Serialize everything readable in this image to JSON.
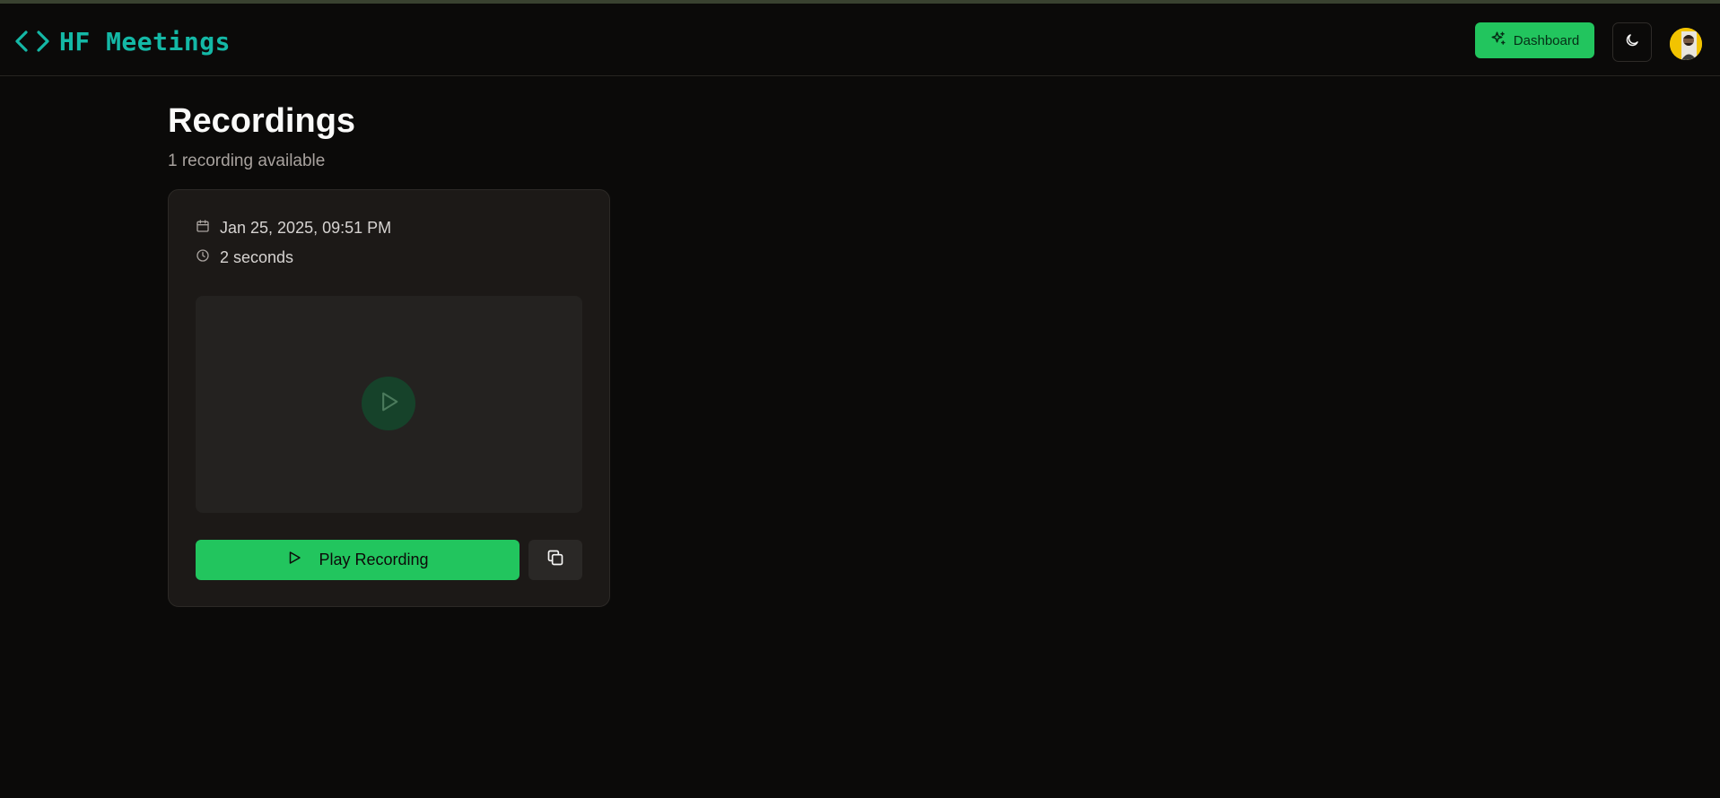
{
  "app": {
    "name": "HF Meetings"
  },
  "header": {
    "dashboard_label": "Dashboard"
  },
  "page": {
    "title": "Recordings",
    "subtitle": "1 recording available"
  },
  "recordings": [
    {
      "date": "Jan 25, 2025, 09:51 PM",
      "duration": "2 seconds",
      "play_label": "Play Recording"
    }
  ],
  "colors": {
    "accent": "#22c55e",
    "brand": "#14b8a6",
    "background": "#0b0a09",
    "card": "#1c1917"
  },
  "icons": {
    "brand": "code-brackets-icon",
    "dashboard": "sparkles-icon",
    "theme": "moon-icon",
    "date": "calendar-icon",
    "duration": "clock-icon",
    "play": "play-icon",
    "copy": "copy-icon"
  }
}
